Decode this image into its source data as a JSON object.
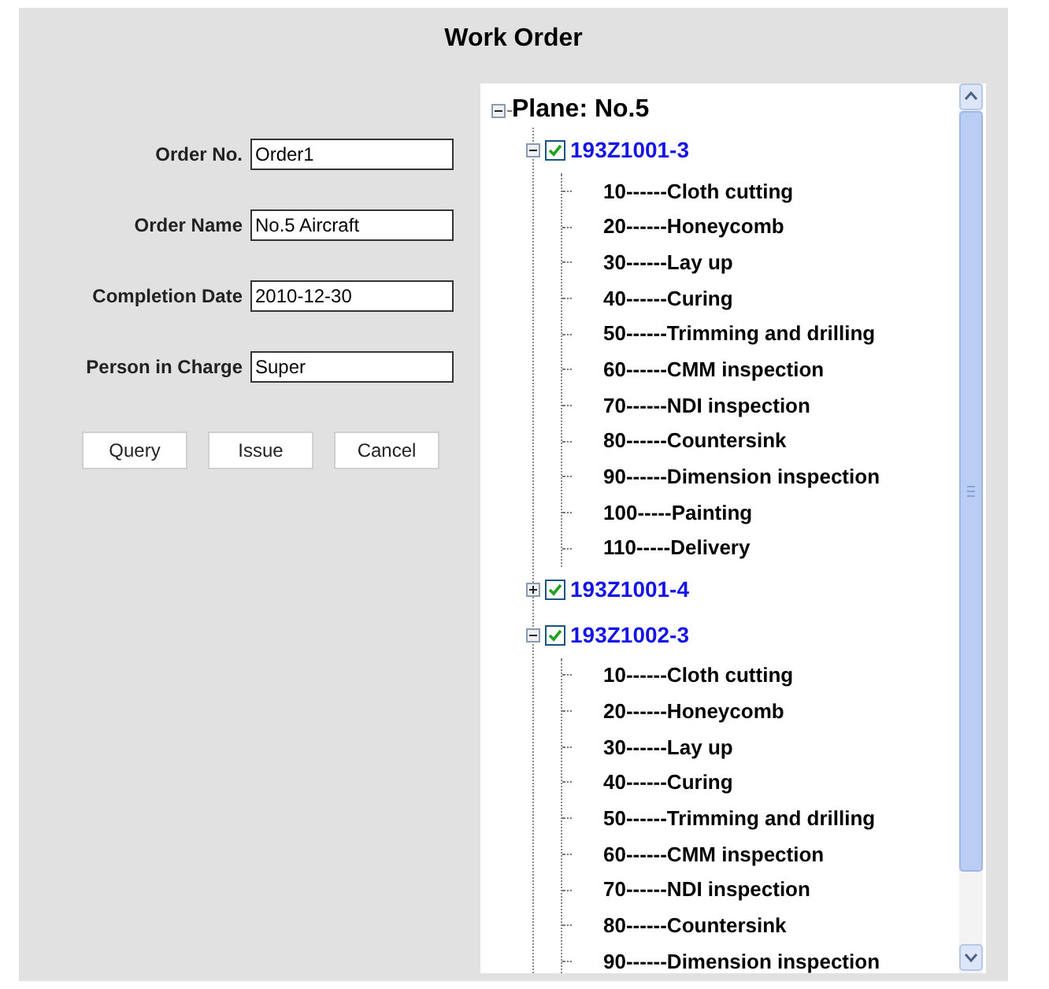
{
  "title": "Work Order",
  "form": {
    "fields": [
      {
        "label": "Order No.",
        "value": "Order1"
      },
      {
        "label": "Order Name",
        "value": "No.5 Aircraft"
      },
      {
        "label": "Completion Date",
        "value": "2010-12-30"
      },
      {
        "label": "Person in Charge",
        "value": "Super"
      }
    ],
    "buttons": [
      "Query",
      "Issue",
      "Cancel"
    ]
  },
  "tree": {
    "label": "Plane: No.5",
    "expanded": true,
    "children": [
      {
        "label": "193Z1001-3",
        "checked": true,
        "expanded": true,
        "children": [
          {
            "label": "10------Cloth cutting"
          },
          {
            "label": "20------Honeycomb"
          },
          {
            "label": "30------Lay up"
          },
          {
            "label": "40------Curing"
          },
          {
            "label": "50------Trimming and drilling"
          },
          {
            "label": "60------CMM inspection"
          },
          {
            "label": "70------NDI inspection"
          },
          {
            "label": "80------Countersink"
          },
          {
            "label": "90------Dimension inspection"
          },
          {
            "label": "100-----Painting"
          },
          {
            "label": "110-----Delivery"
          }
        ]
      },
      {
        "label": "193Z1001-4",
        "checked": true,
        "expanded": false
      },
      {
        "label": "193Z1002-3",
        "checked": true,
        "expanded": true,
        "children": [
          {
            "label": "10------Cloth cutting"
          },
          {
            "label": "20------Honeycomb"
          },
          {
            "label": "30------Lay up"
          },
          {
            "label": "40------Curing"
          },
          {
            "label": "50------Trimming and drilling"
          },
          {
            "label": "60------CMM inspection"
          },
          {
            "label": "70------NDI inspection"
          },
          {
            "label": "80------Countersink"
          },
          {
            "label": "90------Dimension inspection"
          }
        ]
      }
    ]
  }
}
